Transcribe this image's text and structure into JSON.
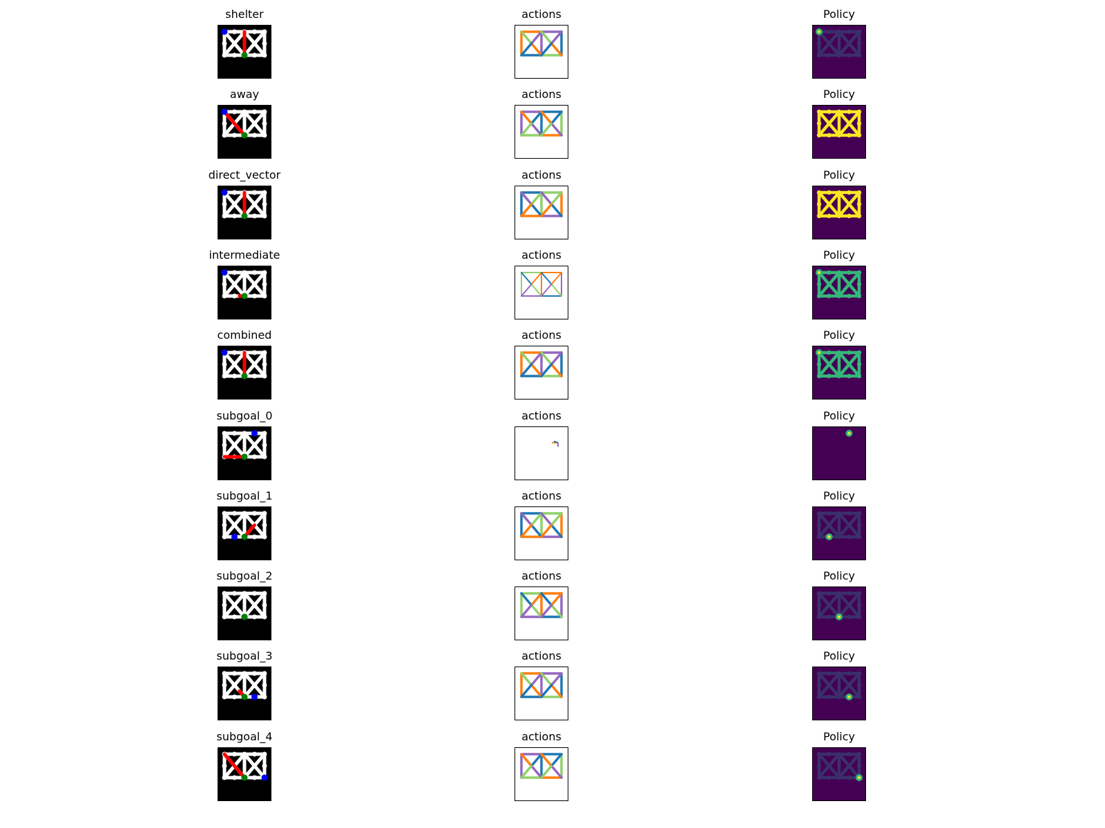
{
  "chart_data": {
    "type": "figure-grid",
    "columns": [
      "maze",
      "actions",
      "Policy"
    ],
    "column_titles": {
      "actions": "actions",
      "policy": "Policy"
    },
    "rows": [
      {
        "title": "shelter",
        "path": [
          [
            4,
            0
          ],
          [
            4,
            4
          ]
        ],
        "blue": 0,
        "policy_level": "low",
        "hot": 0
      },
      {
        "title": "away",
        "path": [
          [
            4,
            4
          ],
          [
            0,
            0
          ]
        ],
        "blue": 0,
        "policy_level": "high",
        "hot": null
      },
      {
        "title": "direct_vector",
        "path": [
          [
            4,
            4
          ],
          [
            4,
            0
          ]
        ],
        "blue": 0,
        "policy_level": "high",
        "hot": null
      },
      {
        "title": "intermediate",
        "path": [
          [
            4,
            4
          ],
          [
            3,
            4
          ]
        ],
        "blue": 0,
        "policy_level": "mid",
        "hot": 0
      },
      {
        "title": "combined",
        "path": [
          [
            4,
            4
          ],
          [
            4,
            0
          ]
        ],
        "blue": 0,
        "policy_level": "mid",
        "hot": 0
      },
      {
        "title": "subgoal_0",
        "path": [
          [
            4,
            4
          ],
          [
            0,
            4
          ]
        ],
        "blue": 9,
        "policy_level": "sparse",
        "hot": 9
      },
      {
        "title": "subgoal_1",
        "path": [
          [
            4,
            4
          ],
          [
            6,
            2
          ]
        ],
        "blue": 10,
        "policy_level": "low",
        "hot": 10
      },
      {
        "title": "subgoal_2",
        "path": [],
        "blue": 4,
        "policy_level": "low",
        "hot": 4
      },
      {
        "title": "subgoal_3",
        "path": [
          [
            4,
            4
          ],
          [
            3,
            3
          ]
        ],
        "blue": 11,
        "policy_level": "low",
        "hot": 11
      },
      {
        "title": "subgoal_4",
        "path": [
          [
            4,
            4
          ],
          [
            0,
            0
          ]
        ],
        "blue": 5,
        "policy_level": "low",
        "hot": 5
      }
    ],
    "colors": {
      "maze_bg": "#000000",
      "maze_edge": "#ffffff",
      "path": "#ff0000",
      "agent": "#0000ff",
      "shelter": "#008000",
      "action_orange": "#ff7f0e",
      "action_purple": "#9467bd",
      "action_blue": "#1f77b4",
      "action_green": "#8fd16a",
      "viridis_dark": "#440154",
      "viridis_low": "#3b2f6b",
      "viridis_mid": "#31688e",
      "viridis_green": "#35b779",
      "viridis_yellow": "#fde725"
    }
  }
}
